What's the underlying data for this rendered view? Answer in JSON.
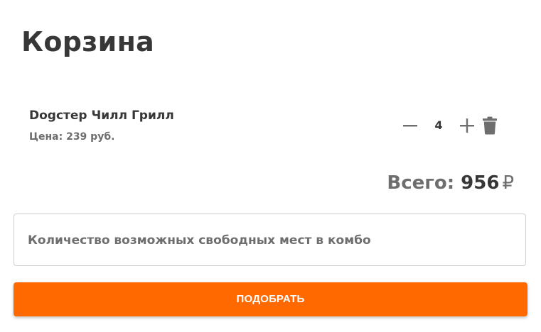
{
  "page": {
    "title": "Корзина"
  },
  "cart": {
    "items": [
      {
        "name": "Dogстер Чилл Грилл",
        "price_label": "Цена:",
        "price": "239 руб.",
        "quantity": "4"
      }
    ],
    "total_label": "Всего:",
    "total_amount": "956",
    "currency_symbol": "₽"
  },
  "combo": {
    "free_slots_label": "Количество возможных свободных мест в комбо"
  },
  "actions": {
    "pick_label": "ПОДОБРАТЬ"
  },
  "icons": {
    "decrease": "minus-icon",
    "increase": "plus-icon",
    "remove": "trash-icon"
  },
  "colors": {
    "accent": "#ff6900",
    "text_dark": "#373737",
    "text_muted": "#6e6e6e",
    "border": "#cfcfcf"
  }
}
